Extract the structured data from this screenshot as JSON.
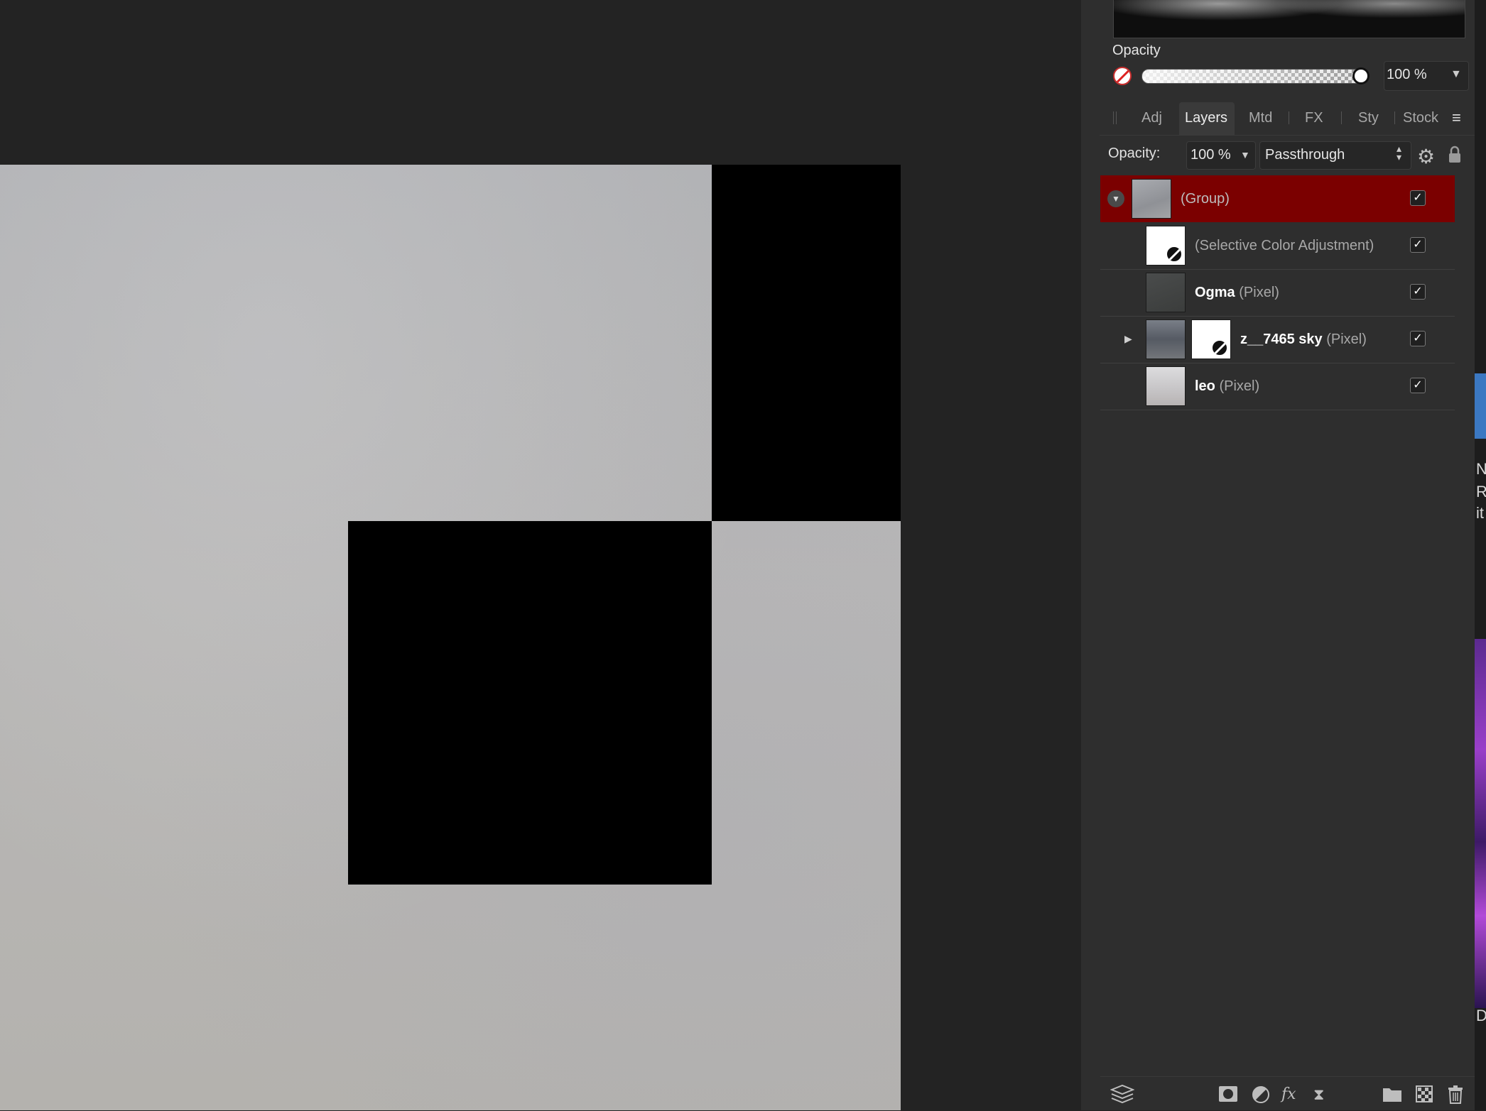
{
  "opacity_panel": {
    "label": "Opacity",
    "value": "100 %",
    "slider_fraction": 1.0
  },
  "tabs": [
    {
      "label": "Adj",
      "active": false
    },
    {
      "label": "Layers",
      "active": true
    },
    {
      "label": "Mtd",
      "active": false
    },
    {
      "label": "FX",
      "active": false
    },
    {
      "label": "Sty",
      "active": false
    },
    {
      "label": "Stock",
      "active": false
    }
  ],
  "layers_panel": {
    "opacity_label": "Opacity:",
    "opacity_value": "100 %",
    "blend_mode": "Passthrough",
    "layers": [
      {
        "name": "",
        "type": "(Group)",
        "selected": true,
        "checked": true
      },
      {
        "name": "",
        "type": "(Selective Color Adjustment)",
        "selected": false,
        "checked": true
      },
      {
        "name": "Ogma",
        "type": "(Pixel)",
        "selected": false,
        "checked": true
      },
      {
        "name": "z__7465 sky",
        "type": "(Pixel)",
        "selected": false,
        "checked": true
      },
      {
        "name": "leo",
        "type": "(Pixel)",
        "selected": false,
        "checked": true
      }
    ]
  },
  "edge_text": [
    "N",
    "R",
    "it",
    "D"
  ],
  "colors": {
    "selected_layer": "#7b0000",
    "panel_bg": "#2e2e2e",
    "canvas_bg": "#232323"
  }
}
